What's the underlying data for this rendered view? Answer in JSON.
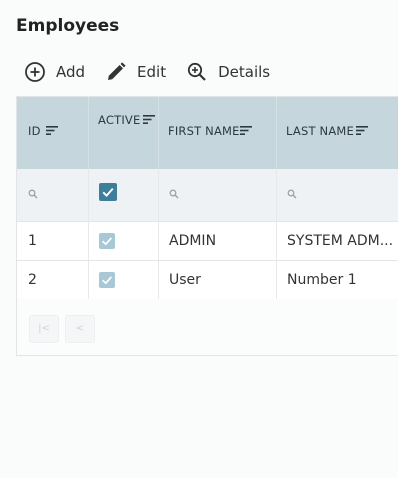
{
  "page": {
    "title": "Employees"
  },
  "toolbar": {
    "add_label": "Add",
    "edit_label": "Edit",
    "details_label": "Details"
  },
  "columns": [
    {
      "key": "id",
      "label": "ID"
    },
    {
      "key": "active",
      "label": "ACTIVE"
    },
    {
      "key": "first_name",
      "label": "FIRST NAME"
    },
    {
      "key": "last_name",
      "label": "LAST NAME"
    }
  ],
  "filter": {
    "active_checked": true
  },
  "rows": [
    {
      "id": "1",
      "active": true,
      "first_name": "ADMIN",
      "last_name": "SYSTEM ADM..."
    },
    {
      "id": "2",
      "active": true,
      "first_name": "User",
      "last_name": "Number 1"
    }
  ],
  "pager": {
    "first_label": "|<",
    "prev_label": "<"
  },
  "icons": {
    "add": "add-circle-icon",
    "edit": "pencil-icon",
    "details": "zoom-in-icon",
    "sort": "sort-icon",
    "search": "search-icon",
    "check": "check-icon"
  },
  "colors": {
    "header_bg": "#c6d6dd",
    "filter_bg": "#eef2f4",
    "checkbox_active": "#3d7e9a",
    "checkbox_readonly": "#a9c8d6"
  }
}
